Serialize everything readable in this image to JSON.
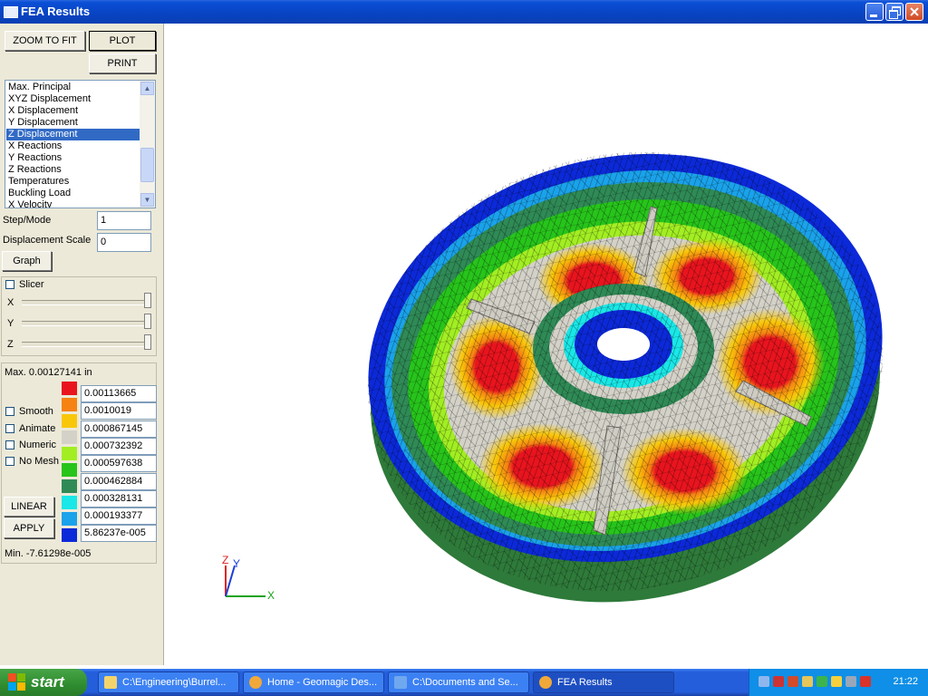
{
  "window": {
    "title": "FEA Results"
  },
  "toolbar": {
    "zoom_to_fit": "ZOOM TO FIT",
    "plot": "PLOT",
    "print": "PRINT"
  },
  "result_types": [
    {
      "label": "Max. Principal",
      "selected": false
    },
    {
      "label": "XYZ Displacement",
      "selected": false
    },
    {
      "label": "X Displacement",
      "selected": false
    },
    {
      "label": "Y Displacement",
      "selected": false
    },
    {
      "label": "Z Displacement",
      "selected": true
    },
    {
      "label": "X Reactions",
      "selected": false
    },
    {
      "label": "Y Reactions",
      "selected": false
    },
    {
      "label": "Z Reactions",
      "selected": false
    },
    {
      "label": "Temperatures",
      "selected": false
    },
    {
      "label": "Buckling Load",
      "selected": false
    },
    {
      "label": "X Velocity",
      "selected": false
    }
  ],
  "fields": {
    "step_mode_label": "Step/Mode",
    "step_mode_value": "1",
    "disp_scale_label": "Displacement Scale",
    "disp_scale_value": "0",
    "graph_label": "Graph"
  },
  "slicer": {
    "label": "Slicer",
    "x": "X",
    "y": "Y",
    "z": "Z"
  },
  "legend": {
    "max_text": "Max. 0.00127141 in",
    "min_text": "Min. -7.61298e-005",
    "values": [
      "0.00113665",
      "0.0010019",
      "0.000867145",
      "0.000732392",
      "0.000597638",
      "0.000462884",
      "0.000328131",
      "0.000193377",
      "5.86237e-005"
    ],
    "colors": [
      "#e8141e",
      "#f58213",
      "#f9c709",
      "#d4d2c8",
      "#a2ee23",
      "#27c41b",
      "#2f8a56",
      "#1ae7e7",
      "#1aa2ea",
      "#0c29d9"
    ]
  },
  "options": {
    "smooth": "Smooth",
    "animate": "Animate",
    "numeric": "Numeric",
    "no_mesh": "No Mesh",
    "linear": "LINEAR",
    "apply": "APPLY"
  },
  "axes": {
    "x": "X",
    "y": "Y",
    "z": "Z"
  },
  "taskbar": {
    "start": "start",
    "tasks": [
      "C:\\Engineering\\Burrel...",
      "Home - Geomagic Des...",
      "C:\\Documents and Se...",
      "FEA Results"
    ],
    "clock": "21:22"
  }
}
